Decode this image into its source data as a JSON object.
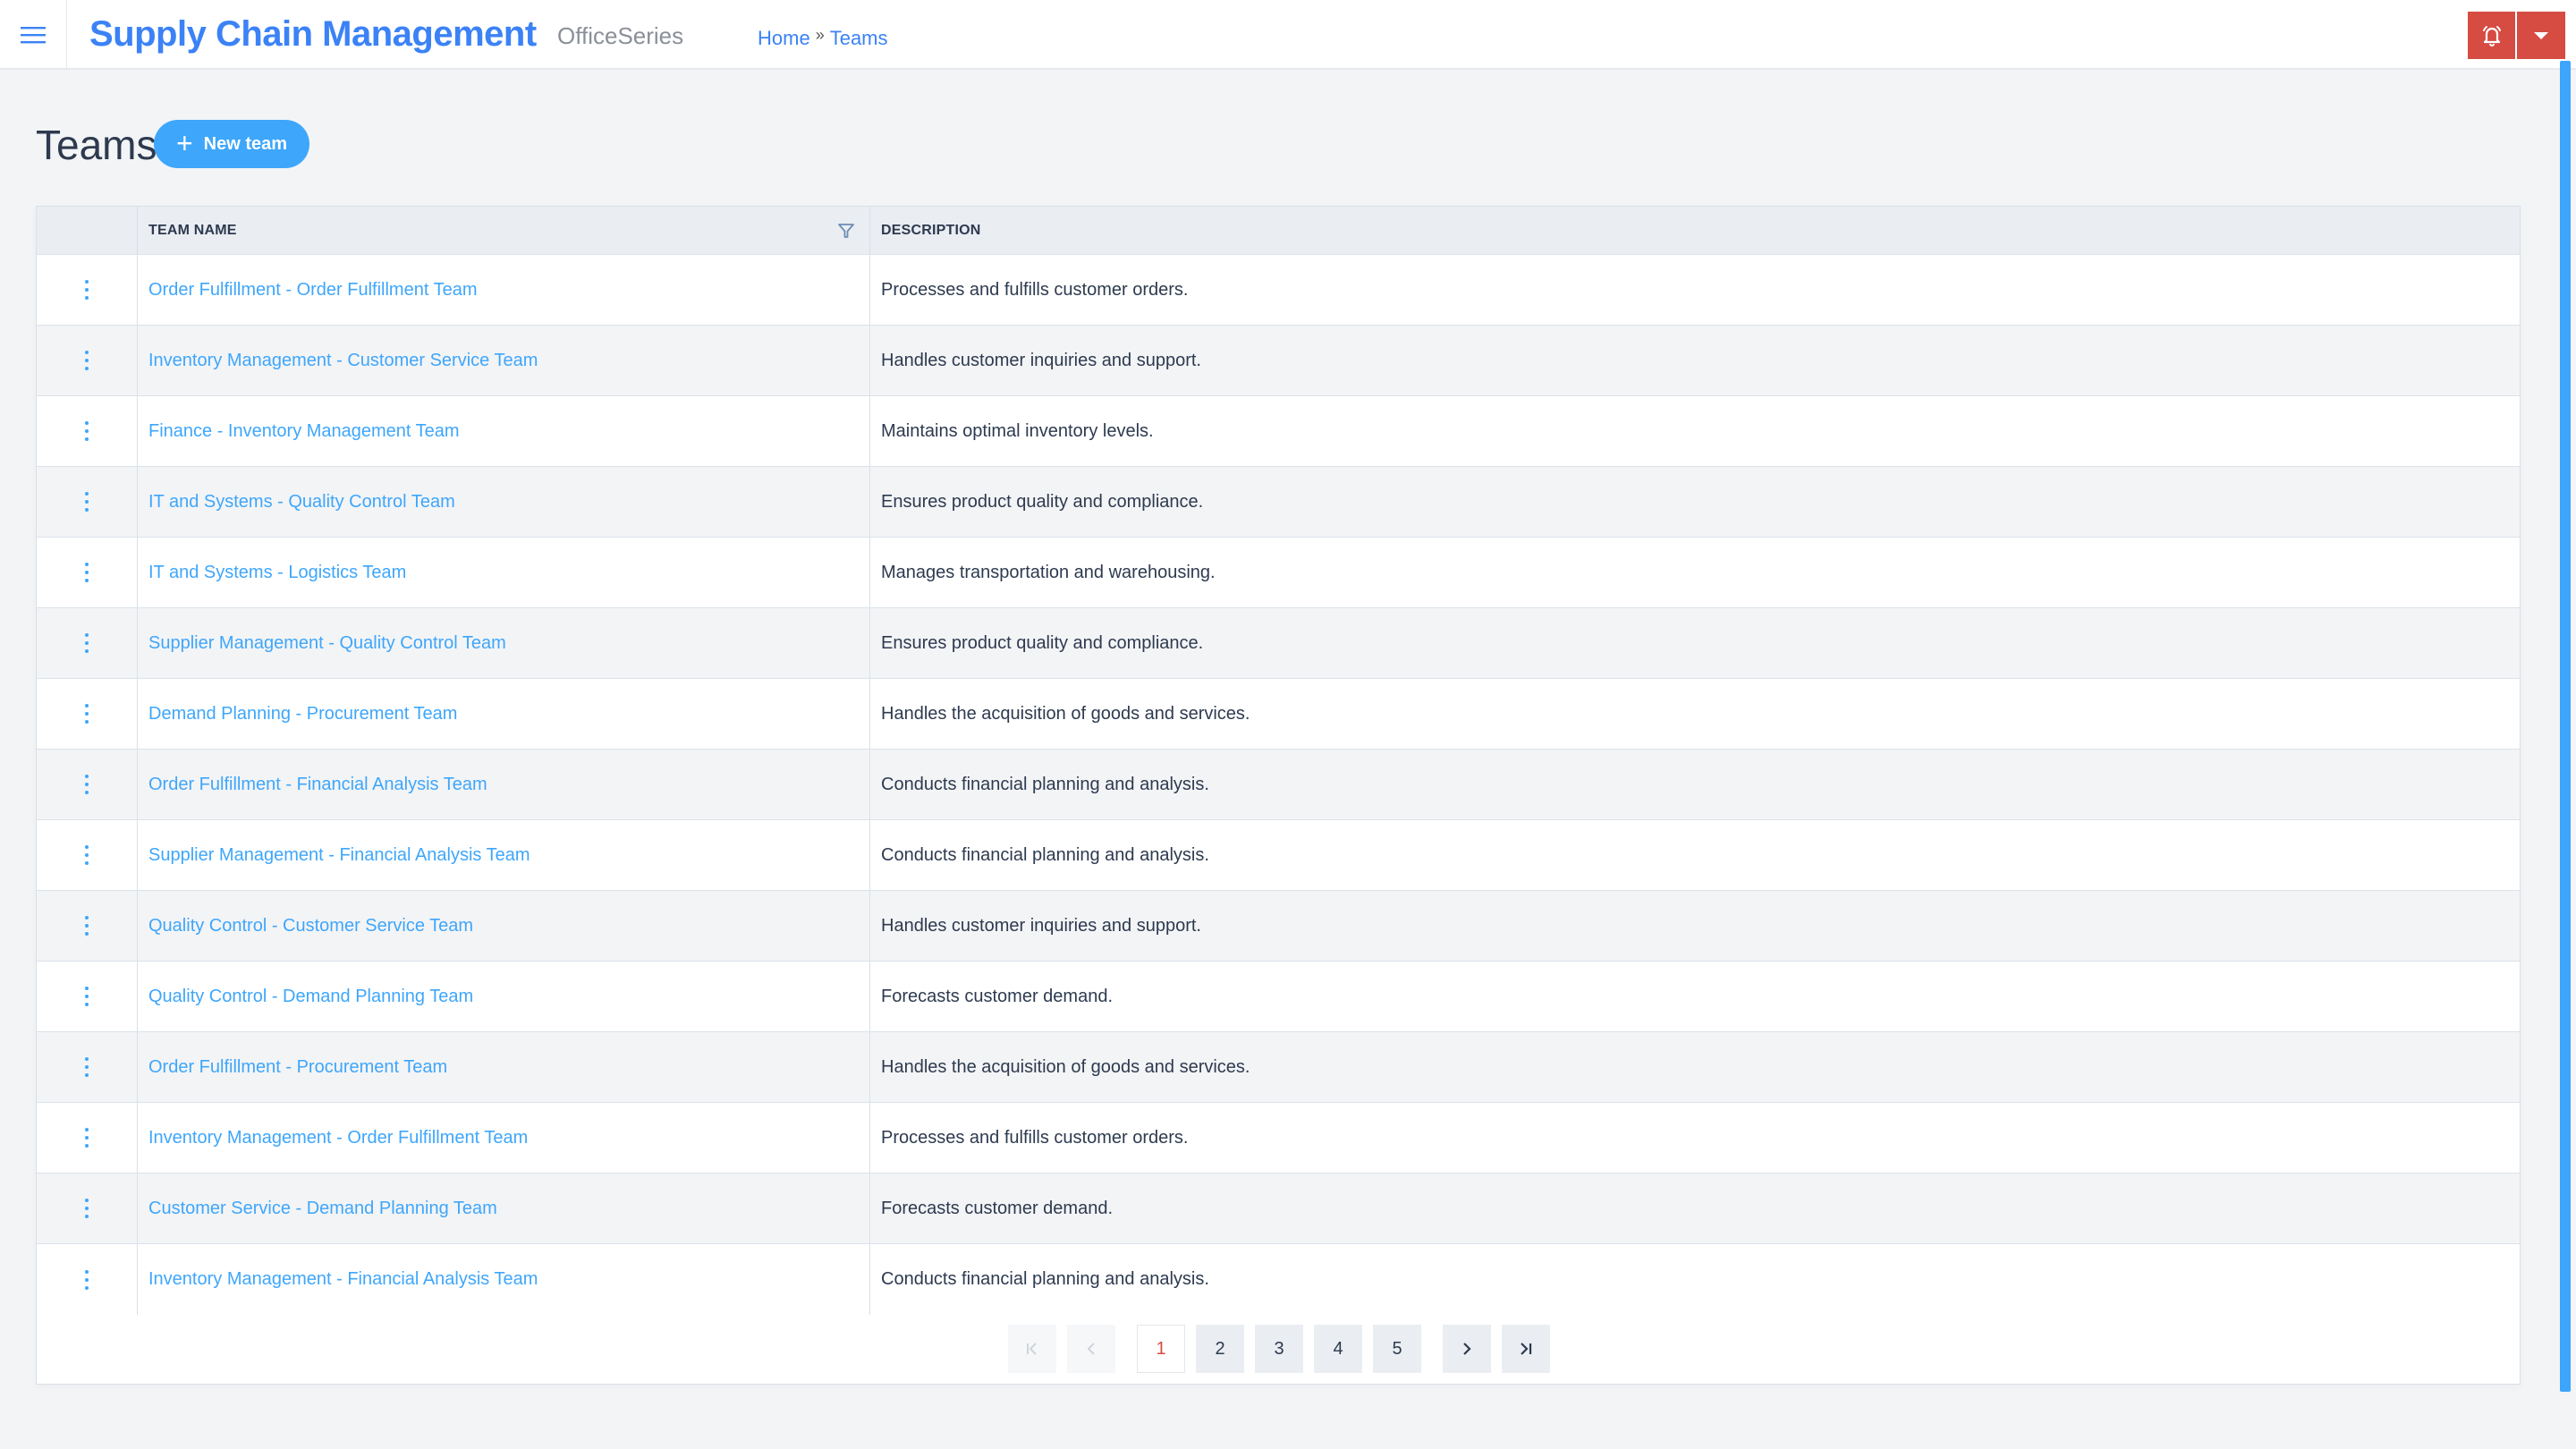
{
  "header": {
    "app_title": "Supply Chain Management",
    "app_subtitle": "OfficeSeries",
    "breadcrumb": [
      {
        "label": "Home"
      },
      {
        "label": "Teams"
      }
    ],
    "breadcrumb_separator": "»",
    "icons": {
      "menu": "hamburger-menu-icon",
      "alert": "bell-ringing-icon",
      "dropdown": "caret-down-icon"
    },
    "accent_color": "#3b82f6",
    "alert_color": "#d64c42"
  },
  "page": {
    "title": "Teams",
    "new_button_label": "New team",
    "new_button_color": "#3ea6fb"
  },
  "table": {
    "columns": [
      {
        "key": "actions",
        "label": ""
      },
      {
        "key": "team_name",
        "label": "TEAM NAME",
        "filterable": true
      },
      {
        "key": "description",
        "label": "DESCRIPTION"
      }
    ],
    "rows": [
      {
        "team_name": "Order Fulfillment - Order Fulfillment Team",
        "description": "Processes and fulfills customer orders."
      },
      {
        "team_name": "Inventory Management - Customer Service Team",
        "description": "Handles customer inquiries and support."
      },
      {
        "team_name": "Finance - Inventory Management Team",
        "description": "Maintains optimal inventory levels."
      },
      {
        "team_name": "IT and Systems - Quality Control Team",
        "description": "Ensures product quality and compliance."
      },
      {
        "team_name": "IT and Systems - Logistics Team",
        "description": "Manages transportation and warehousing."
      },
      {
        "team_name": "Supplier Management - Quality Control Team",
        "description": "Ensures product quality and compliance."
      },
      {
        "team_name": "Demand Planning - Procurement Team",
        "description": "Handles the acquisition of goods and services."
      },
      {
        "team_name": "Order Fulfillment - Financial Analysis Team",
        "description": "Conducts financial planning and analysis."
      },
      {
        "team_name": "Supplier Management - Financial Analysis Team",
        "description": "Conducts financial planning and analysis."
      },
      {
        "team_name": "Quality Control - Customer Service Team",
        "description": "Handles customer inquiries and support."
      },
      {
        "team_name": "Quality Control - Demand Planning Team",
        "description": "Forecasts customer demand."
      },
      {
        "team_name": "Order Fulfillment - Procurement Team",
        "description": "Handles the acquisition of goods and services."
      },
      {
        "team_name": "Inventory Management - Order Fulfillment Team",
        "description": "Processes and fulfills customer orders."
      },
      {
        "team_name": "Customer Service - Demand Planning Team",
        "description": "Forecasts customer demand."
      },
      {
        "team_name": "Inventory Management - Financial Analysis Team",
        "description": "Conducts financial planning and analysis."
      }
    ]
  },
  "pagination": {
    "current_page": 1,
    "pages": [
      "1",
      "2",
      "3",
      "4",
      "5"
    ],
    "first_disabled": true,
    "prev_disabled": true,
    "active_color": "#d64c42"
  }
}
